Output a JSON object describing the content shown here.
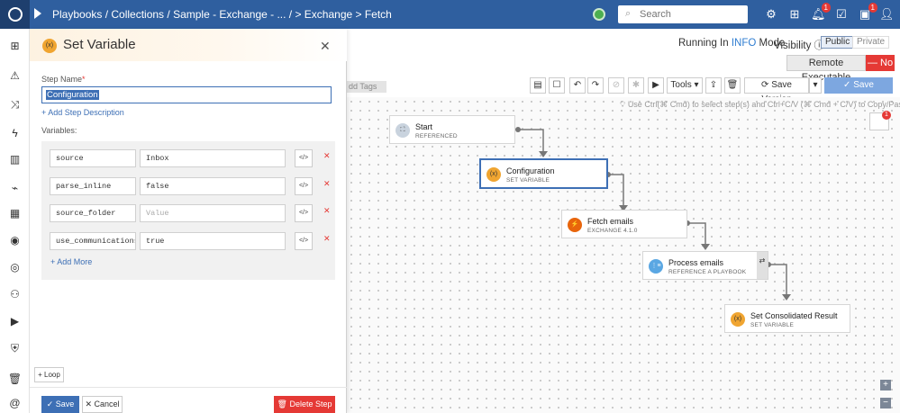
{
  "topbar": {
    "breadcrumb": "Playbooks / Collections / Sample - Exchange - ... /   > Exchange > Fetch",
    "search_placeholder": "Search",
    "notifications_badge": "1",
    "messages_badge": "1"
  },
  "header": {
    "running_prefix": "Running In",
    "running_mode": "INFO",
    "running_suffix": "Mode",
    "visibility_label": "Visibility",
    "public_label": "Public",
    "private_label": "Private",
    "remote_label": "Remote Executable",
    "remote_value": "— No"
  },
  "toolbar": {
    "add_tags": "dd Tags",
    "tools": "Tools",
    "save_version": "Save Version",
    "save_playbook": "Save Playbook"
  },
  "canvas": {
    "hint": "Use Ctrl(⌘ Cmd) to select step(s) and Ctrl+C/V (⌘ Cmd + C/V) to Copy/Paste.",
    "avatar_badge": "1",
    "zoom_in": "+",
    "zoom_out": "−",
    "nodes": [
      {
        "title": "Start",
        "subtitle": "REFERENCED",
        "icon": "start-icon"
      },
      {
        "title": "Configuration",
        "subtitle": "SET VARIABLE",
        "icon": "variable-icon"
      },
      {
        "title": "Fetch emails",
        "subtitle": "EXCHANGE 4.1.0",
        "icon": "connector-icon"
      },
      {
        "title": "Process emails",
        "subtitle": "REFERENCE A PLAYBOOK",
        "icon": "playbook-ref-icon"
      },
      {
        "title": "Set Consolidated Result",
        "subtitle": "SET VARIABLE",
        "icon": "variable-icon"
      }
    ]
  },
  "panel": {
    "icon_text": "(x)",
    "title": "Set Variable",
    "step_name_label": "Step Name",
    "step_name_value": "Configuration",
    "add_description": "+ Add Step Description",
    "variables_label": "Variables:",
    "variables": [
      {
        "key": "source",
        "value": "Inbox",
        "placeholder": ""
      },
      {
        "key": "parse_inline",
        "value": "false",
        "placeholder": ""
      },
      {
        "key": "source_folder",
        "value": "",
        "placeholder": "Value"
      },
      {
        "key": "use_communications",
        "value": "true",
        "placeholder": ""
      }
    ],
    "add_more": "+ Add More",
    "loop": "+ Loop",
    "save": "✓ Save",
    "cancel": "✕ Cancel",
    "delete": "Delete Step"
  },
  "colors": {
    "topbar": "#2f5f9f",
    "accent": "#3d6fb5",
    "danger": "#e53935",
    "variable_icon": "#f0a531"
  }
}
